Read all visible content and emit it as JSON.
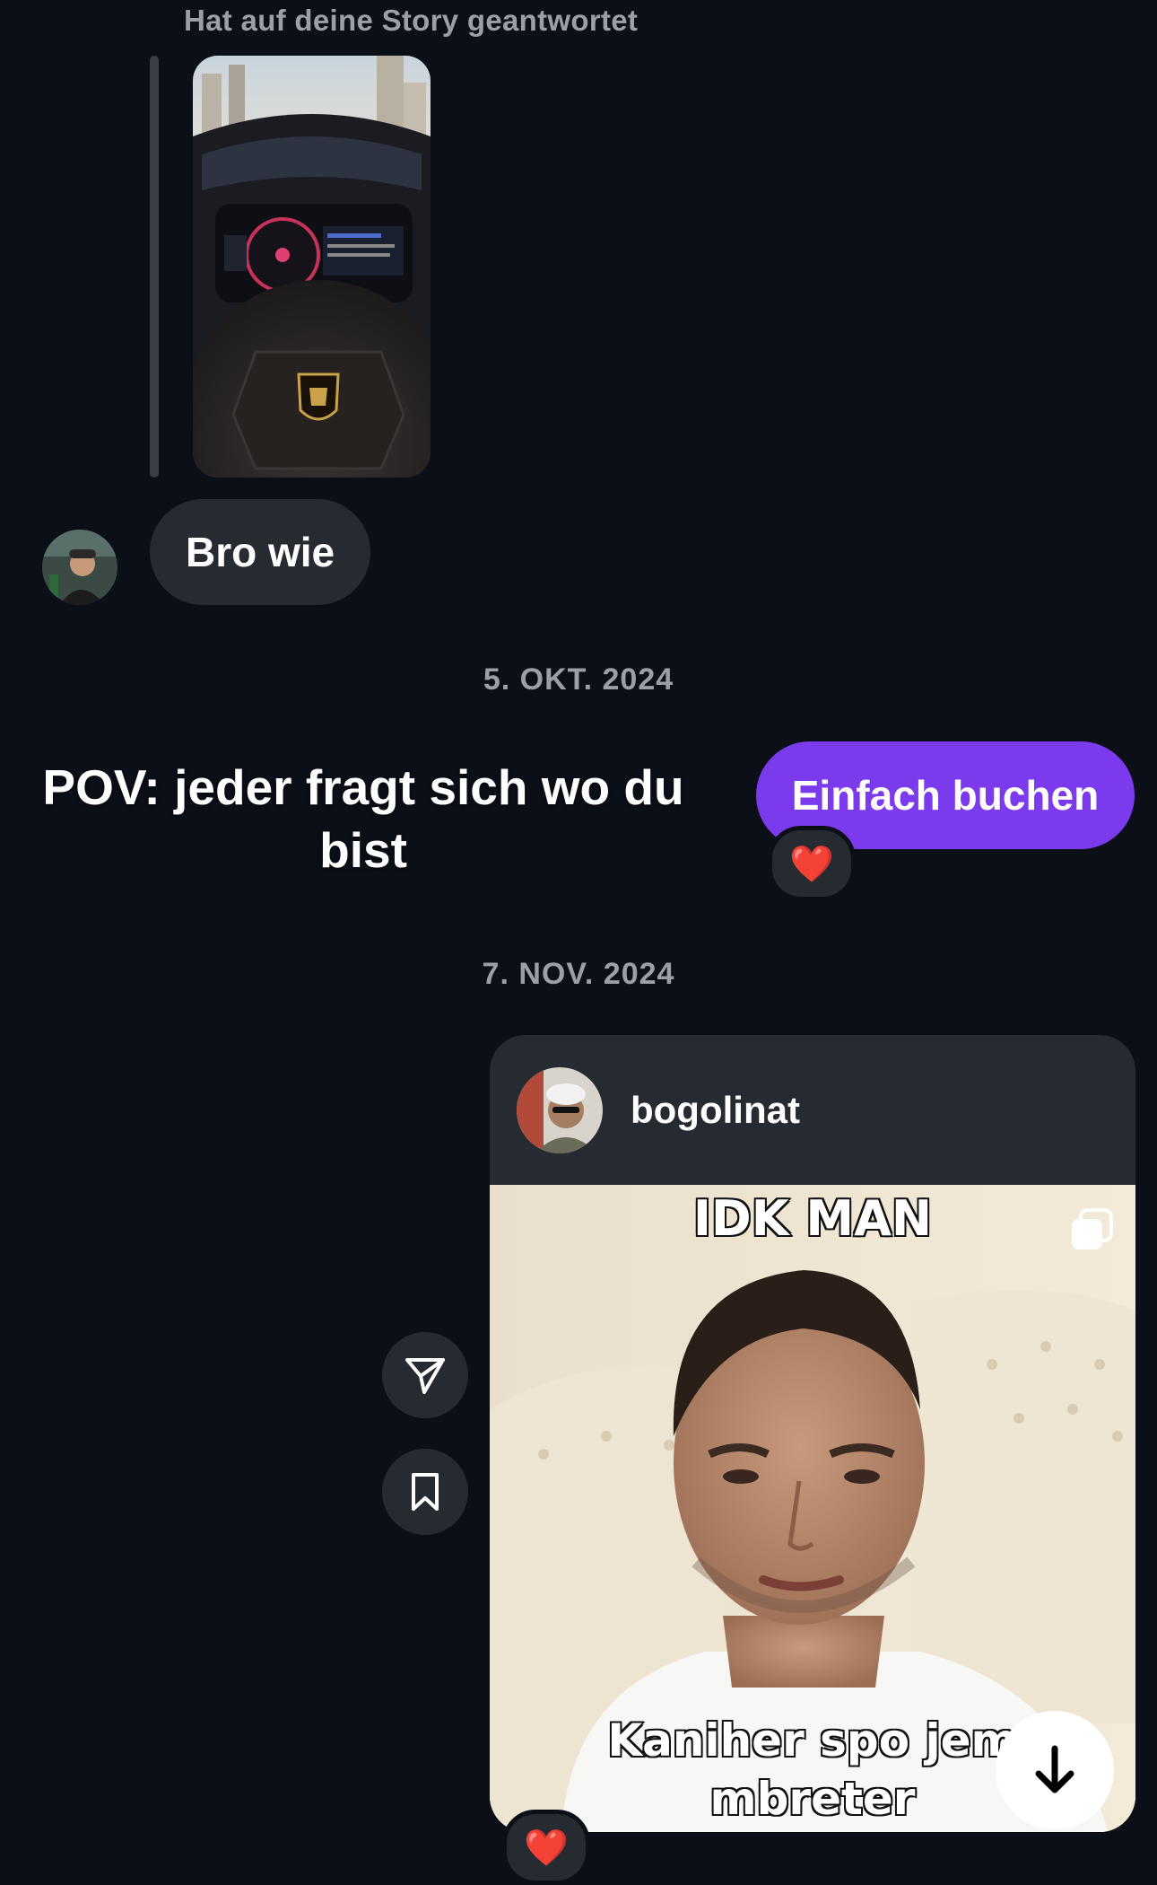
{
  "story_reply": {
    "caption": "Hat auf deine Story geantwortet"
  },
  "messages": {
    "incoming_text": "Bro wie",
    "date_1": "5. OKT. 2024",
    "pov_text": "POV: jeder fragt sich wo du bist",
    "outgoing_text": "Einfach buchen",
    "reaction_1": "❤️",
    "date_2": "7. NOV. 2024",
    "reaction_2": "❤️"
  },
  "shared_post": {
    "username": "bogolinat",
    "meme_top": "IDK MAN",
    "meme_bottom_line1": "Kaniher spo jem",
    "meme_bottom_line2": "mbreter"
  },
  "icons": {
    "share": "paper-plane-icon",
    "save": "bookmark-icon",
    "scroll_down": "arrow-down-icon",
    "carousel": "multiple-images-icon"
  },
  "colors": {
    "background": "#0b1018",
    "bubble_incoming": "#262a31",
    "bubble_outgoing": "#7c3aed"
  }
}
